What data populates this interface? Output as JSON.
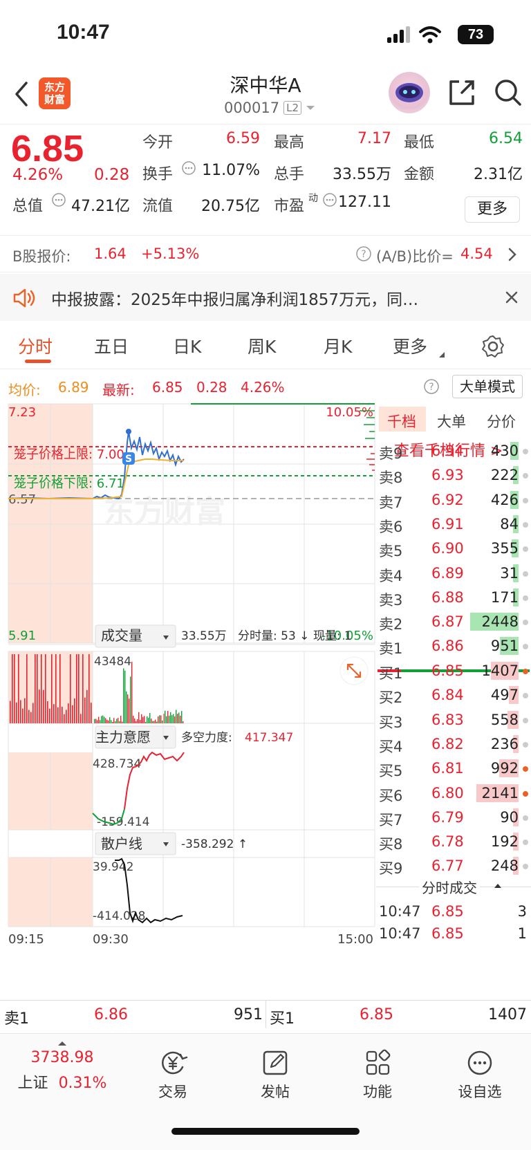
{
  "status": {
    "time": "10:47",
    "battery": "73"
  },
  "header": {
    "logo_line1": "东方",
    "logo_line2": "财富",
    "name": "深中华A",
    "code": "000017",
    "level": "L2"
  },
  "quote": {
    "price": "6.85",
    "change_pct": "4.26%",
    "change": "0.28",
    "open_label": "今开",
    "open": "6.59",
    "high_label": "最高",
    "high": "7.17",
    "low_label": "最低",
    "low": "6.54",
    "turnover_label": "换手",
    "turnover": "11.07%",
    "volume_label": "总手",
    "volume": "33.55万",
    "amount_label": "金额",
    "amount": "2.31亿",
    "mktcap_label": "总值",
    "mktcap": "47.21亿",
    "float_label": "流值",
    "float": "20.75亿",
    "pe_label": "市盈",
    "pe_sup": "动",
    "pe": "127.11",
    "more": "更多"
  },
  "bshare": {
    "label": "B股报价:",
    "price": "1.64",
    "pct": "+5.13%",
    "ratio_label": "(A/B)比价=",
    "ratio": "4.54"
  },
  "announce": {
    "text": "中报披露：2025年中报归属净利润1857万元，同…"
  },
  "tabs": [
    "分时",
    "五日",
    "日K",
    "周K",
    "月K",
    "更多"
  ],
  "inforow": {
    "avg_label": "均价:",
    "avg": "6.89",
    "latest_label": "最新:",
    "latest": "6.85",
    "chg": "0.28",
    "pct": "4.26%",
    "bigorder": "大单模式"
  },
  "chart": {
    "price_top": "7.23",
    "price_bottom": "5.91",
    "pct_top": "10.05%",
    "pct_bottom": "-10.05%",
    "prev_close": "6.57",
    "cage_upper": "笼子价格上限: 7.00",
    "cage_lower": "笼子价格下限: 6.71",
    "watermark": "东方财富",
    "s_marker": "S",
    "vol_panel": {
      "label": "成交量",
      "total": "33.55万",
      "detail": "分时量: 53 ↓ 现量: 1",
      "max": "43484"
    },
    "main_panel": {
      "label": "主力意愿",
      "strength_label": "多空力度:",
      "strength": "417.347",
      "top": "428.734",
      "bottom": "-159.414"
    },
    "retail_panel": {
      "label": "散户线",
      "value": "-358.292 ↑",
      "top": "39.942",
      "bottom": "-414.028"
    },
    "time_start": "09:15",
    "time_open": "09:30",
    "time_end": "15:00",
    "colors": {
      "price_line": "#2f6fd0",
      "avg_line": "#f0b030",
      "up": "#e8222f",
      "down": "#10a036"
    }
  },
  "orderbook": {
    "tabs": [
      "千档",
      "大单",
      "分价"
    ],
    "link": "查看千档行情 >",
    "asks": [
      {
        "label": "卖9",
        "price": "6.94",
        "vol": "430"
      },
      {
        "label": "卖8",
        "price": "6.93",
        "vol": "222"
      },
      {
        "label": "卖7",
        "price": "6.92",
        "vol": "426"
      },
      {
        "label": "卖6",
        "price": "6.91",
        "vol": "84"
      },
      {
        "label": "卖5",
        "price": "6.90",
        "vol": "355"
      },
      {
        "label": "卖4",
        "price": "6.89",
        "vol": "31"
      },
      {
        "label": "卖3",
        "price": "6.88",
        "vol": "171"
      },
      {
        "label": "卖2",
        "price": "6.87",
        "vol": "2448"
      },
      {
        "label": "卖1",
        "price": "6.86",
        "vol": "951"
      }
    ],
    "bids": [
      {
        "label": "买1",
        "price": "6.85",
        "vol": "1407"
      },
      {
        "label": "买2",
        "price": "6.84",
        "vol": "497"
      },
      {
        "label": "买3",
        "price": "6.83",
        "vol": "558"
      },
      {
        "label": "买4",
        "price": "6.82",
        "vol": "236"
      },
      {
        "label": "买5",
        "price": "6.81",
        "vol": "992"
      },
      {
        "label": "买6",
        "price": "6.80",
        "vol": "2141"
      },
      {
        "label": "买7",
        "price": "6.79",
        "vol": "90"
      },
      {
        "label": "买8",
        "price": "6.78",
        "vol": "192"
      },
      {
        "label": "买9",
        "price": "6.77",
        "vol": "248"
      }
    ],
    "trades_title": "分时成交",
    "trades": [
      {
        "time": "10:47",
        "price": "6.85",
        "vol": "3"
      },
      {
        "time": "10:47",
        "price": "6.85",
        "vol": "1"
      }
    ]
  },
  "bottom_ba": {
    "ask_label": "卖1",
    "ask_price": "6.86",
    "ask_vol": "951",
    "bid_label": "买1",
    "bid_price": "6.85",
    "bid_vol": "1407"
  },
  "nav": {
    "index_value": "3738.98",
    "index_name": "上证",
    "index_pct": "0.31%",
    "items": [
      "交易",
      "发帖",
      "功能",
      "设自选"
    ]
  }
}
